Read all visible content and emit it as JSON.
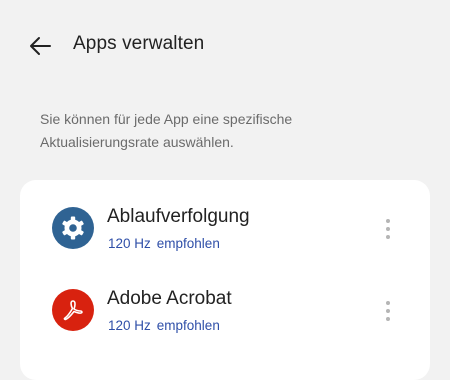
{
  "header": {
    "title": "Apps verwalten"
  },
  "description": "Sie können für jede App eine spezifische Aktualisierungsrate auswählen.",
  "apps": [
    {
      "name": "Ablaufverfolgung",
      "rate": "120 Hz",
      "recommendation": "empfohlen",
      "icon": "gear-icon",
      "icon_color": "#2f6393"
    },
    {
      "name": "Adobe Acrobat",
      "rate": "120 Hz",
      "recommendation": "empfohlen",
      "icon": "adobe-acrobat-icon",
      "icon_color": "#d8220f"
    }
  ],
  "colors": {
    "background": "#f2f2f2",
    "card": "#ffffff",
    "accent": "#2f4fa8"
  }
}
